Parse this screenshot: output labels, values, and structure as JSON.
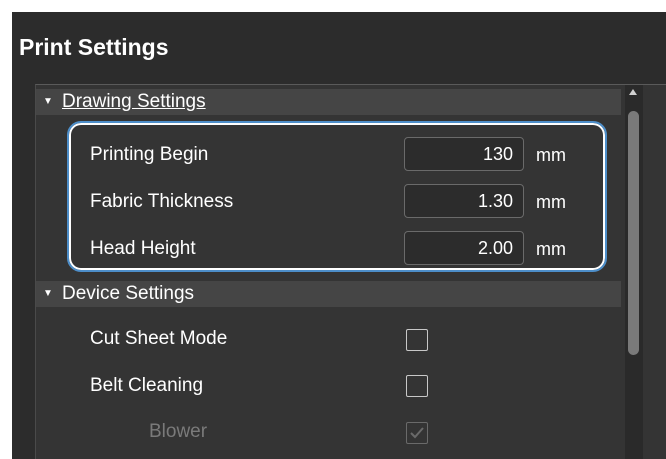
{
  "window": {
    "title": "Print Settings"
  },
  "sections": {
    "drawing": {
      "label": "Drawing Settings",
      "rows": [
        {
          "label": "Printing Begin",
          "value": "130",
          "unit": "mm"
        },
        {
          "label": "Fabric Thickness",
          "value": "1.30",
          "unit": "mm"
        },
        {
          "label": "Head Height",
          "value": "2.00",
          "unit": "mm"
        }
      ]
    },
    "device": {
      "label": "Device Settings",
      "rows": [
        {
          "label": "Cut Sheet Mode",
          "checked": false,
          "enabled": true
        },
        {
          "label": "Belt Cleaning",
          "checked": false,
          "enabled": true
        },
        {
          "label": "Blower",
          "checked": true,
          "enabled": false
        }
      ]
    }
  },
  "colors": {
    "background": "#2c2c2c",
    "highlight": "#4d8ec9"
  }
}
